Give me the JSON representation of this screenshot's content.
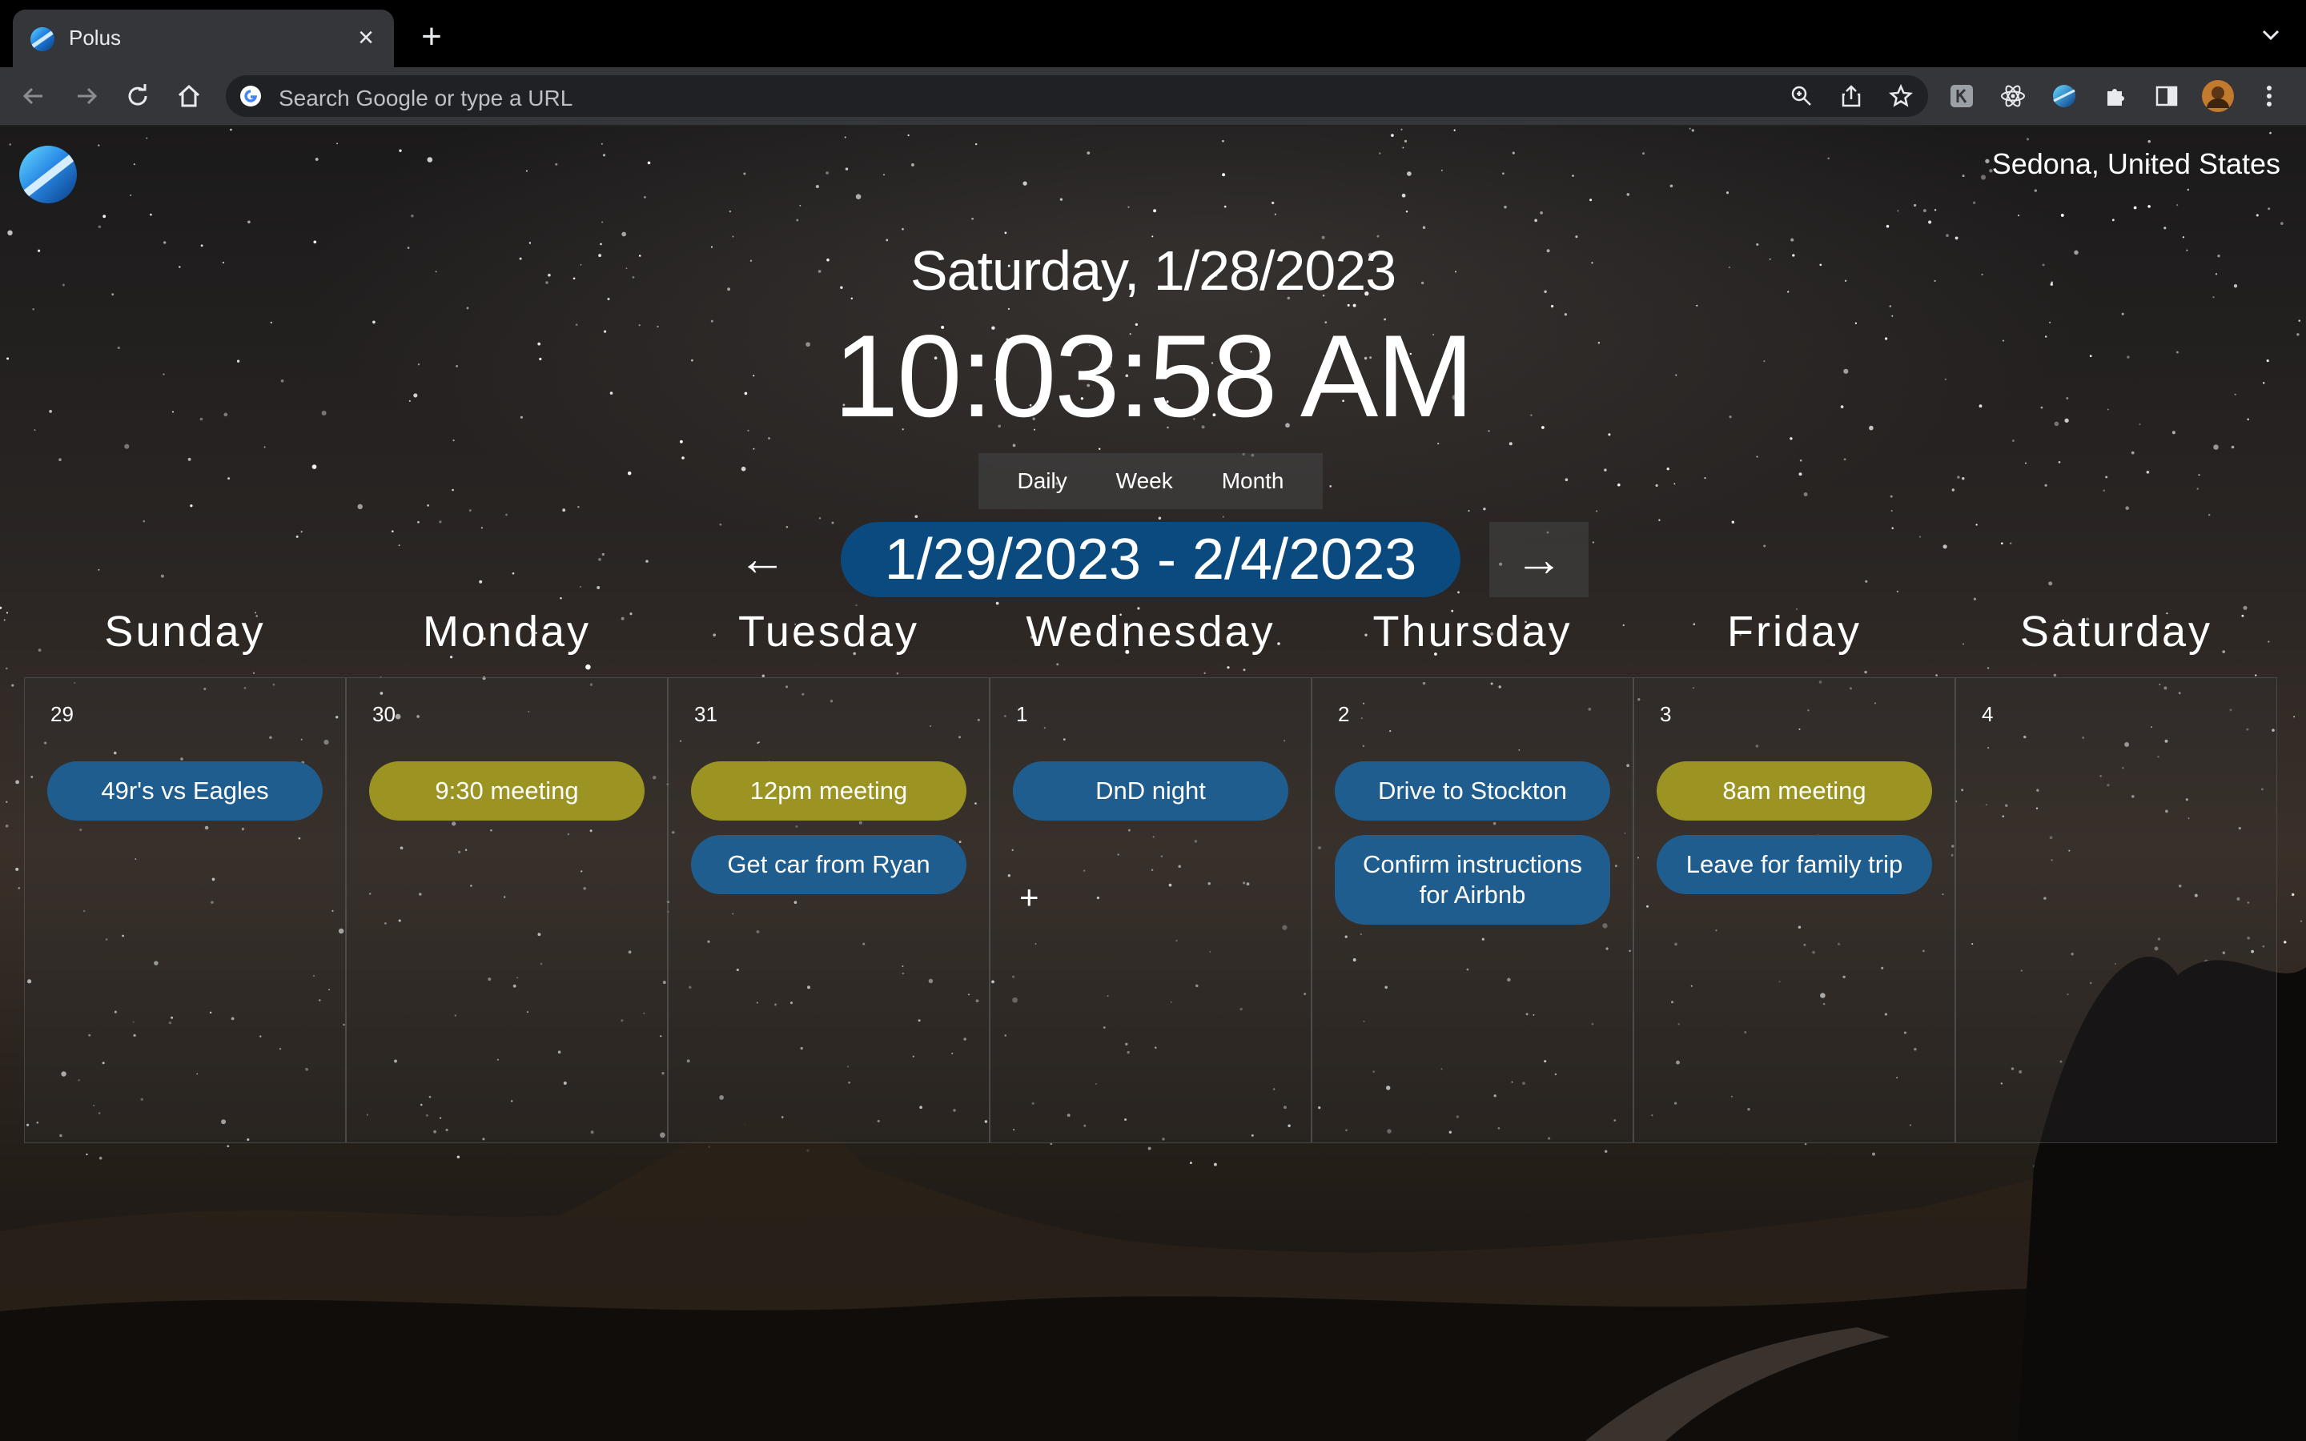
{
  "browser": {
    "tab_title": "Polus",
    "omnibox_placeholder": "Search Google or type a URL"
  },
  "app": {
    "location": "Sedona, United States",
    "date_heading": "Saturday, 1/28/2023",
    "clock": "10:03:58 AM",
    "views": [
      "Daily",
      "Week",
      "Month"
    ],
    "range": "1/29/2023 - 2/4/2023",
    "prev_arrow": "←",
    "next_arrow": "→",
    "add_symbol": "+",
    "colors": {
      "blue_event": "#1f5d8e",
      "olive_event": "#9c9422",
      "range_pill": "#0b4a7e"
    }
  },
  "week": [
    {
      "day": "Sunday",
      "date": "29",
      "events": [
        {
          "title": "49r's vs Eagles",
          "color": "blue"
        }
      ]
    },
    {
      "day": "Monday",
      "date": "30",
      "events": [
        {
          "title": "9:30 meeting",
          "color": "olive"
        }
      ]
    },
    {
      "day": "Tuesday",
      "date": "31",
      "events": [
        {
          "title": "12pm meeting",
          "color": "olive"
        },
        {
          "title": "Get car from Ryan",
          "color": "blue"
        }
      ]
    },
    {
      "day": "Wednesday",
      "date": "1",
      "events": [
        {
          "title": "DnD night",
          "color": "blue"
        }
      ]
    },
    {
      "day": "Thursday",
      "date": "2",
      "events": [
        {
          "title": "Drive to Stockton",
          "color": "blue"
        },
        {
          "title": "Confirm instructions for Airbnb",
          "color": "blue"
        }
      ]
    },
    {
      "day": "Friday",
      "date": "3",
      "events": [
        {
          "title": "8am meeting",
          "color": "olive"
        },
        {
          "title": "Leave for family trip",
          "color": "blue"
        }
      ]
    },
    {
      "day": "Saturday",
      "date": "4",
      "events": []
    }
  ]
}
